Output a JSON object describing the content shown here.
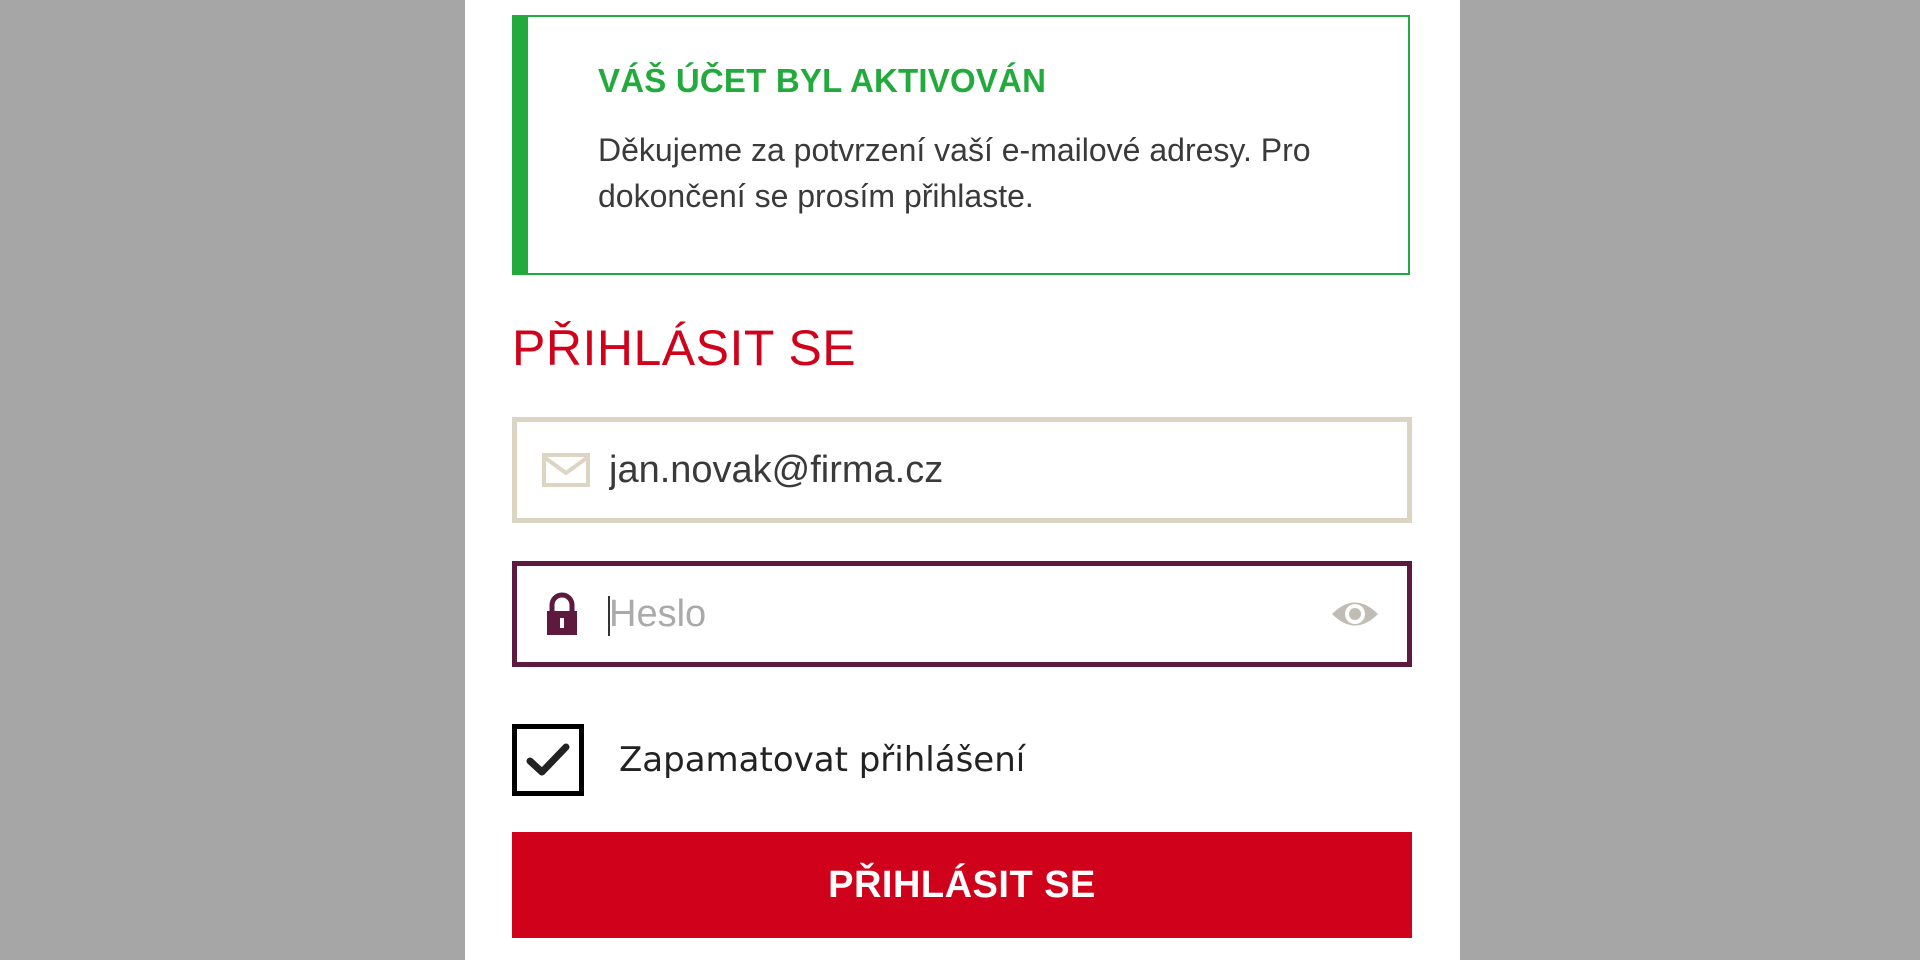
{
  "alert": {
    "title": "VÁŠ ÚČET BYL AKTIVOVÁN",
    "text_line1": "Děkujeme za potvrzení vaší e-mailové adresy. Pro",
    "text_line2": "dokončení se prosím přihlaste.",
    "color": "#22aa3c"
  },
  "login": {
    "title": "PŘIHLÁSIT SE",
    "email": {
      "icon": "envelope-icon",
      "value": "jan.novak@firma.cz"
    },
    "password": {
      "icon": "lock-icon",
      "placeholder": "Heslo",
      "value": "",
      "toggle_icon": "eye-icon"
    },
    "remember": {
      "label": "Zapamatovat přihlášení",
      "checked": true
    },
    "submit_label": "PŘIHLÁSIT SE"
  },
  "colors": {
    "brand_red": "#d0021b",
    "focus_border": "#5e1a3e",
    "input_border": "#ddd5c3",
    "backdrop": "#a6a6a6"
  }
}
